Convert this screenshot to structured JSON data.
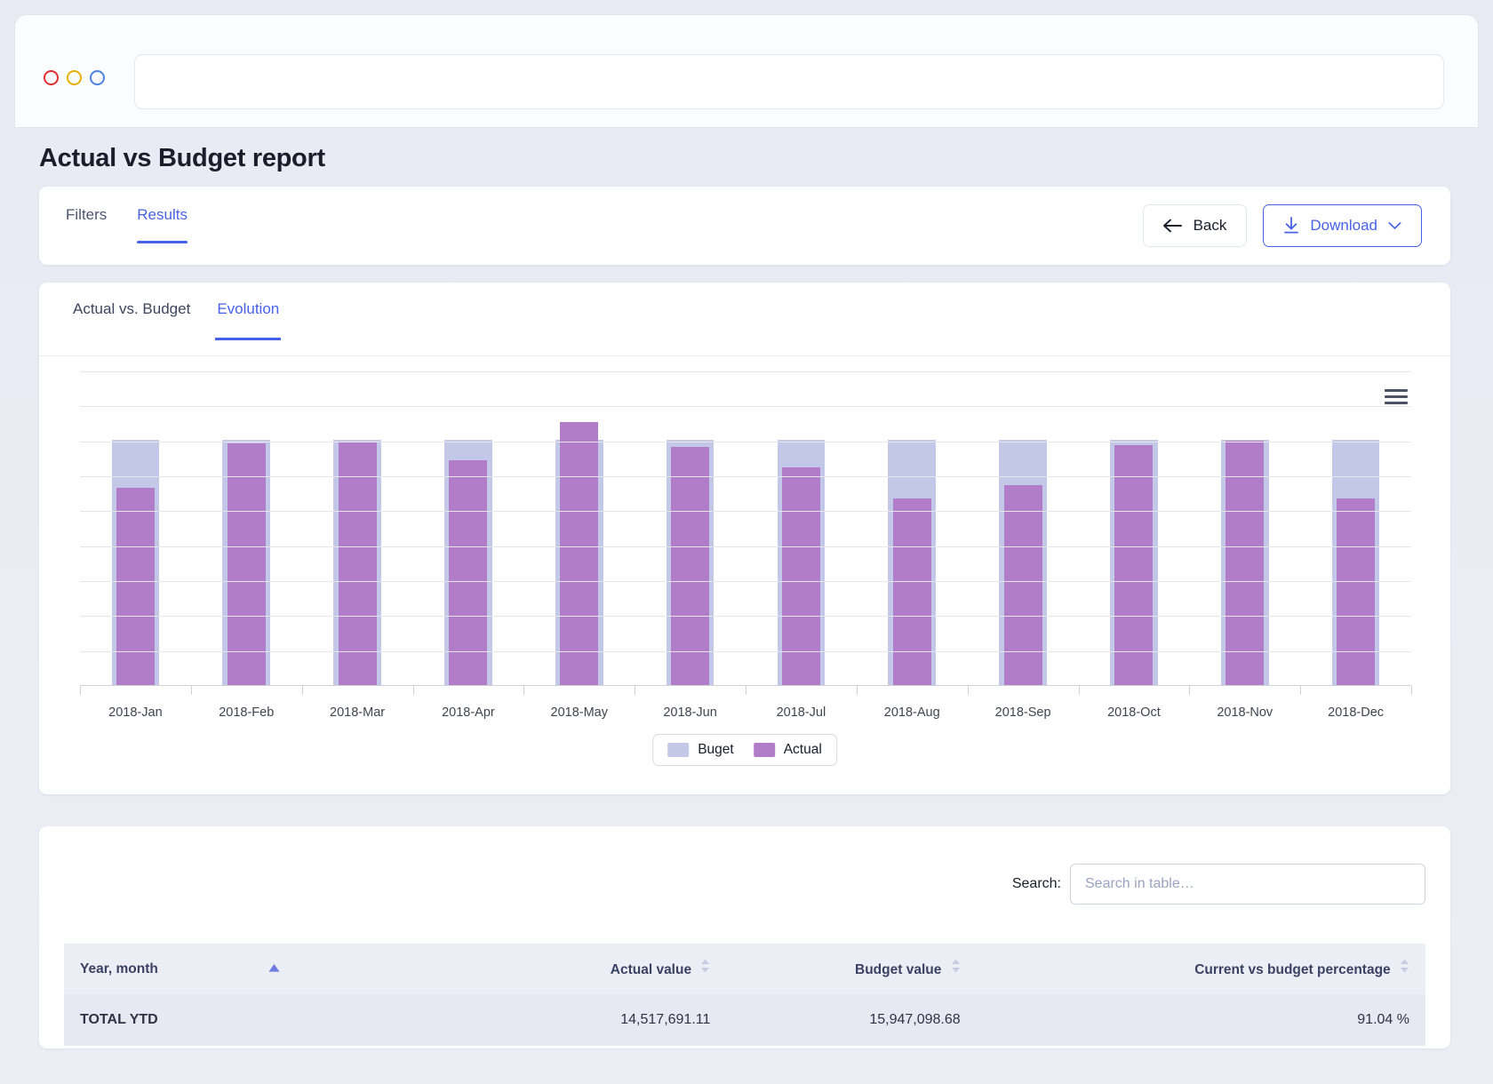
{
  "browser": {
    "dots": [
      "red",
      "yellow",
      "blue"
    ],
    "url": ""
  },
  "header": {
    "title": "Actual vs Budget report"
  },
  "toolbar": {
    "tabs": [
      {
        "label": "Filters",
        "active": false
      },
      {
        "label": "Results",
        "active": true
      }
    ],
    "back_label": "Back",
    "download_label": "Download"
  },
  "chart_panel": {
    "tabs": [
      {
        "label": "Actual vs. Budget",
        "active": false
      },
      {
        "label": "Evolution",
        "active": true
      }
    ],
    "menu_icon": "hamburger-icon"
  },
  "table_panel": {
    "search_label": "Search:",
    "search_placeholder": "Search in table…",
    "search_value": "",
    "columns": [
      {
        "label": "Year, month",
        "align": "left",
        "sorted": "asc"
      },
      {
        "label": "Actual value",
        "align": "right",
        "sorted": "none"
      },
      {
        "label": "Budget value",
        "align": "right",
        "sorted": "none"
      },
      {
        "label": "Current vs budget percentage",
        "align": "right",
        "sorted": "none"
      }
    ],
    "rows": [
      {
        "year_month": "TOTAL YTD",
        "actual_value": "14,517,691.11",
        "budget_value": "15,947,098.68",
        "percentage": "91.04 %"
      }
    ]
  },
  "colors": {
    "budget": "#c3c7e8",
    "actual": "#b27dc8",
    "accent": "#4762e8",
    "grid": "#e6e6ea"
  },
  "chart_data": {
    "type": "bar",
    "title": "",
    "xlabel": "",
    "ylabel": "",
    "grid": true,
    "legend_position": "bottom",
    "ylim": [
      0,
      1700000
    ],
    "categories": [
      "2018-Jan",
      "2018-Feb",
      "2018-Mar",
      "2018-Apr",
      "2018-May",
      "2018-Jun",
      "2018-Jul",
      "2018-Aug",
      "2018-Sep",
      "2018-Oct",
      "2018-Nov",
      "2018-Dec"
    ],
    "series": [
      {
        "name": "Buget",
        "color": "#c3c7e8",
        "values": [
          1330000,
          1330000,
          1330000,
          1330000,
          1330000,
          1330000,
          1330000,
          1330000,
          1330000,
          1330000,
          1330000,
          1330000
        ]
      },
      {
        "name": "Actual",
        "color": "#b27dc8",
        "values": [
          1072000,
          1310000,
          1322000,
          1222000,
          1428000,
          1292000,
          1180000,
          1015000,
          1085000,
          1300000,
          1325000,
          1013000
        ]
      }
    ]
  }
}
